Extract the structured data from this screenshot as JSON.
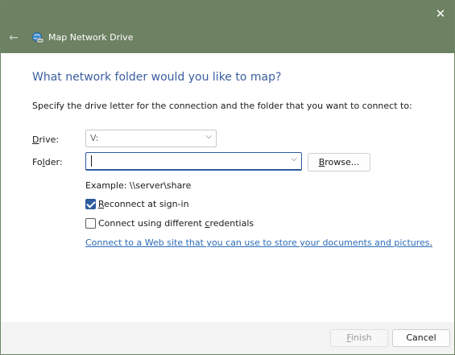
{
  "window": {
    "title": "Map Network Drive",
    "close_glyph": "✕",
    "back_glyph": "←"
  },
  "content": {
    "heading": "What network folder would you like to map?",
    "instruction": "Specify the drive letter for the connection and the folder that you want to connect to:",
    "drive": {
      "label_underlined": "D",
      "label_rest": "rive:",
      "value": "V:"
    },
    "folder": {
      "label_pre": "Fo",
      "label_underlined": "l",
      "label_rest": "der:",
      "value": "",
      "placeholder": ""
    },
    "browse": {
      "label_underlined": "B",
      "label_rest": "rowse..."
    },
    "example": "Example: \\\\server\\share",
    "reconnect": {
      "checked": true,
      "label_underlined": "R",
      "label_rest": "econnect at sign-in"
    },
    "credentials": {
      "checked": false,
      "label_pre": "Connect using different ",
      "label_underlined": "c",
      "label_rest": "redentials"
    },
    "link": "Connect to a Web site that you can use to store your documents and pictures",
    "link_suffix": "."
  },
  "footer": {
    "finish_underlined": "F",
    "finish_rest": "inish",
    "cancel": "Cancel"
  },
  "colors": {
    "titlebar": "#6d8163",
    "accent": "#2e5c9e",
    "heading": "#3a5f9e",
    "link": "#2b6bb8"
  }
}
